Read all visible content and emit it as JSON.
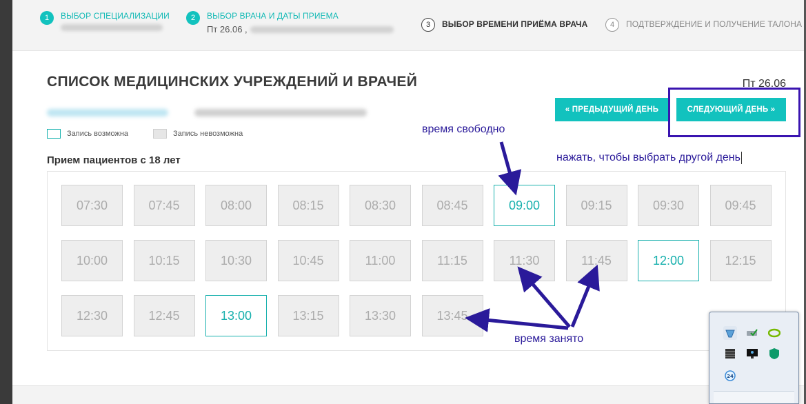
{
  "steps": [
    {
      "num": "1",
      "title": "ВЫБОР СПЕЦИАЛИЗАЦИИ"
    },
    {
      "num": "2",
      "title": "ВЫБОР ВРАЧА И ДАТЫ ПРИЕМА",
      "date": "Пт 26.06 ,"
    },
    {
      "num": "3",
      "title": "ВЫБОР ВРЕМЕНИ ПРИЁМА ВРАЧА"
    },
    {
      "num": "4",
      "title": "ПОДТВЕРЖДЕНИЕ И ПОЛУЧЕНИЕ ТАЛОНА"
    }
  ],
  "main": {
    "title": "СПИСОК МЕДИЦИНСКИХ УЧРЕЖДЕНИЙ И ВРАЧЕЙ",
    "date": "Пт 26.06",
    "prev_button": "« ПРЕДЫДУЩИЙ ДЕНЬ",
    "next_button": "СЛЕДУЮЩИЙ ДЕНЬ »",
    "legend_free": "Запись возможна",
    "legend_busy": "Запись невозможна",
    "section_title": "Прием пациентов с 18 лет"
  },
  "slots": [
    {
      "time": "07:30",
      "status": "busy"
    },
    {
      "time": "07:45",
      "status": "busy"
    },
    {
      "time": "08:00",
      "status": "busy"
    },
    {
      "time": "08:15",
      "status": "busy"
    },
    {
      "time": "08:30",
      "status": "busy"
    },
    {
      "time": "08:45",
      "status": "busy"
    },
    {
      "time": "09:00",
      "status": "free"
    },
    {
      "time": "09:15",
      "status": "busy"
    },
    {
      "time": "09:30",
      "status": "busy"
    },
    {
      "time": "09:45",
      "status": "busy"
    },
    {
      "time": "10:00",
      "status": "busy"
    },
    {
      "time": "10:15",
      "status": "busy"
    },
    {
      "time": "10:30",
      "status": "busy"
    },
    {
      "time": "10:45",
      "status": "busy"
    },
    {
      "time": "11:00",
      "status": "busy"
    },
    {
      "time": "11:15",
      "status": "busy"
    },
    {
      "time": "11:30",
      "status": "busy"
    },
    {
      "time": "11:45",
      "status": "busy"
    },
    {
      "time": "12:00",
      "status": "free"
    },
    {
      "time": "12:15",
      "status": "busy"
    },
    {
      "time": "12:30",
      "status": "busy"
    },
    {
      "time": "12:45",
      "status": "busy"
    },
    {
      "time": "13:00",
      "status": "free"
    },
    {
      "time": "13:15",
      "status": "busy"
    },
    {
      "time": "13:30",
      "status": "busy"
    },
    {
      "time": "13:45",
      "status": "busy"
    }
  ],
  "annotations": {
    "free": "время свободно",
    "busy": "время занято",
    "next_day": "нажать, чтобы выбрать другой день"
  },
  "tray": {
    "icons": [
      "wifi-icon",
      "drive-check-icon",
      "nvidia-icon",
      "archive-icon",
      "monitor-icon",
      "shield-icon",
      "clock-24-icon"
    ],
    "clock_label": "24"
  },
  "colors": {
    "accent": "#12c2be",
    "annotation": "#2a1a9a"
  }
}
